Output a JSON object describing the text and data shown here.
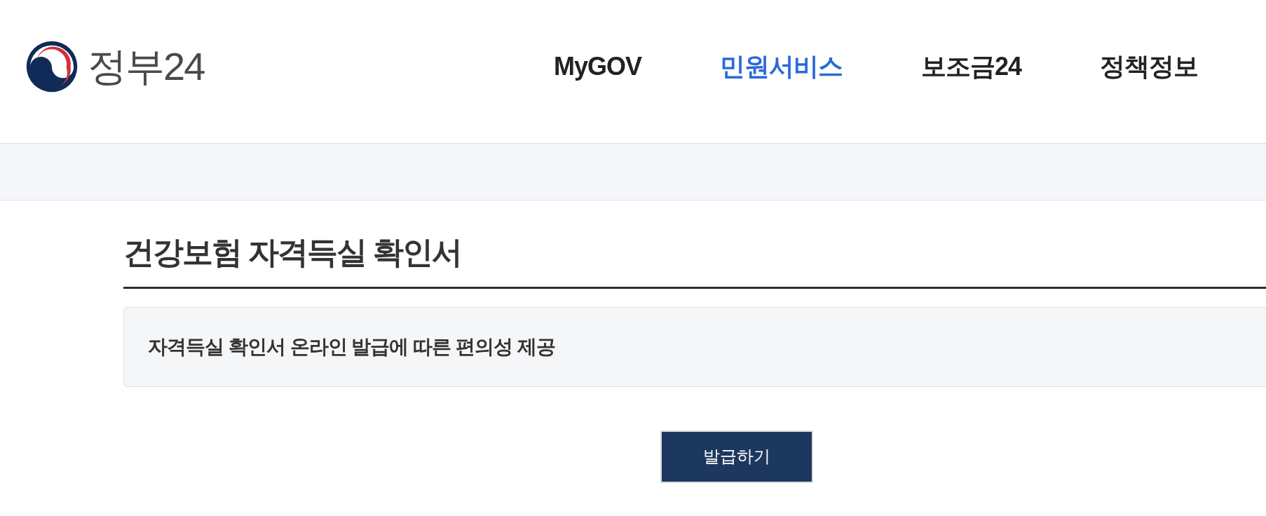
{
  "logo": {
    "text": "정부24"
  },
  "nav": [
    {
      "label": "MyGOV",
      "selected": false
    },
    {
      "label": "민원서비스",
      "selected": true
    },
    {
      "label": "보조금24",
      "selected": false
    },
    {
      "label": "정책정보",
      "selected": false
    }
  ],
  "page": {
    "title": "건강보험 자격득실 확인서",
    "description": "자격득실 확인서 온라인 발급에 따른 편의성 제공"
  },
  "buttons": [
    {
      "label": "발급하기"
    }
  ]
}
